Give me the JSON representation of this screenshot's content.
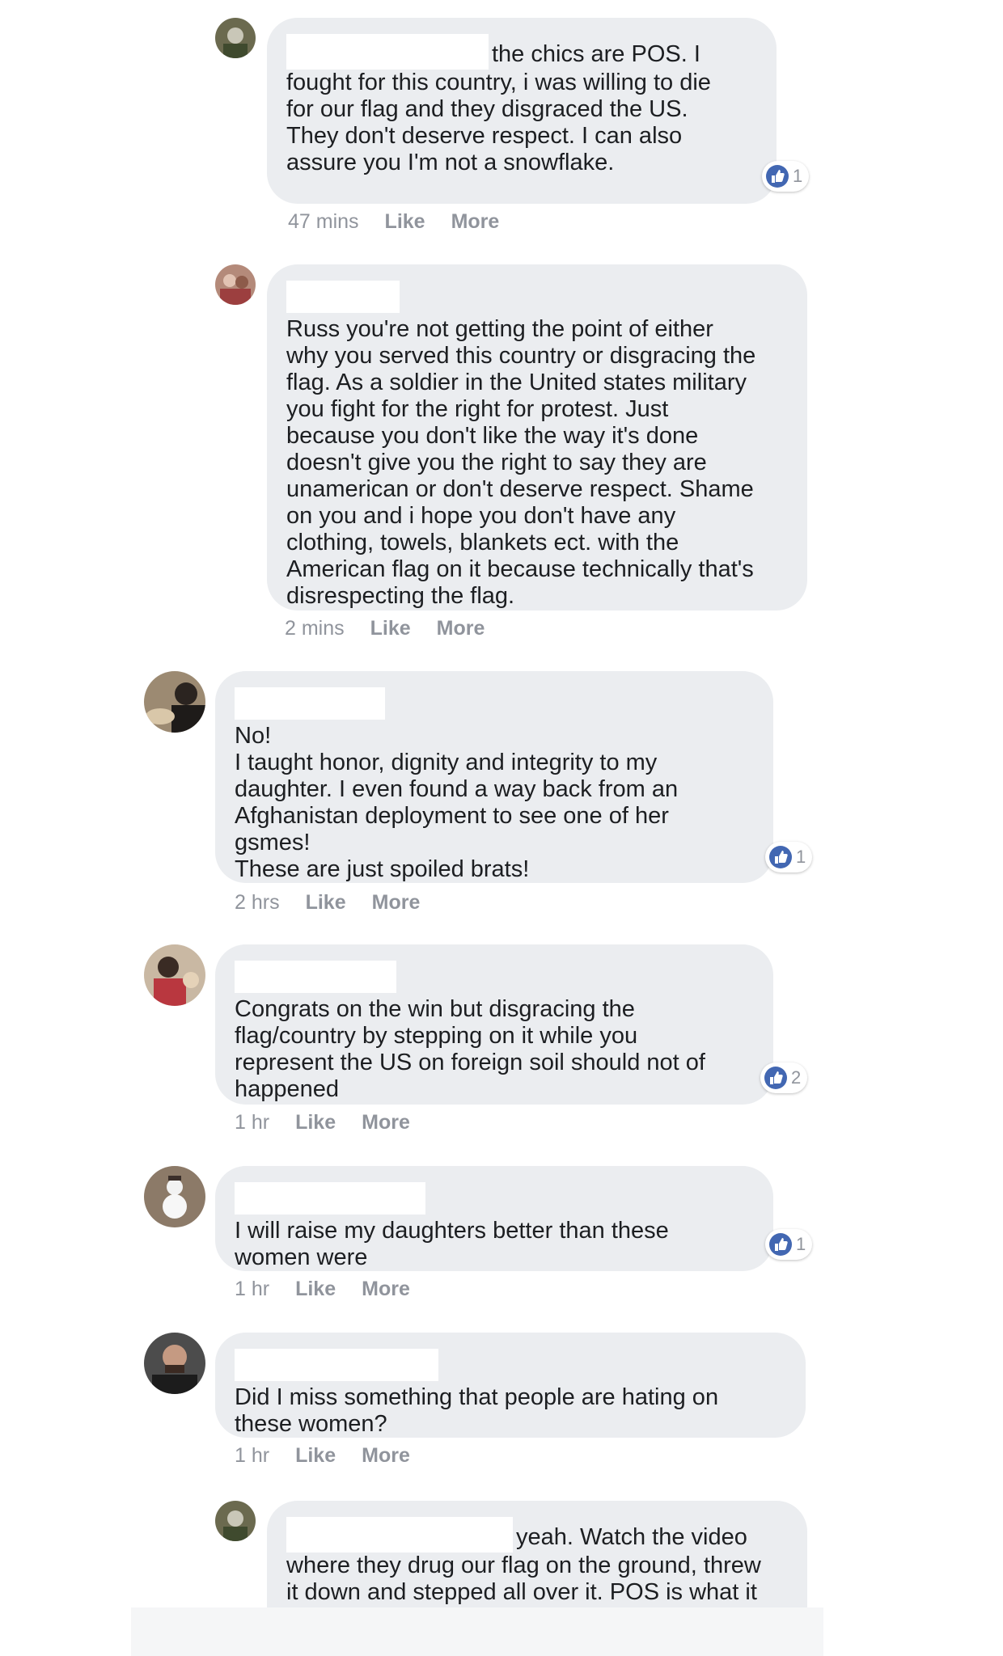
{
  "comments": [
    {
      "text": "fought for this country, i was willing to die\nfor our flag and they disgraced the US.\nThey don't deserve respect. I can also\nassure you I'm not a snowflake.",
      "first_line": "the chics are POS. I",
      "time": "47 mins",
      "like": "Like",
      "more": "More",
      "reactions": "1"
    },
    {
      "text": "Russ you're not getting the point of either\nwhy you served this country or disgracing the\nflag. As a soldier in the United states military\nyou fight for the right for protest. Just\nbecause you don't like the way it's done\ndoesn't give you the right to say they are\nunamerican or don't deserve respect. Shame\non you and i hope you don't have any\nclothing, towels, blankets ect. with the\nAmerican flag on it because technically that's\ndisrespecting the flag.",
      "time": "2 mins",
      "like": "Like",
      "more": "More"
    },
    {
      "text": "No!\nI taught honor, dignity and integrity to my\ndaughter. I even found a way back from an\nAfghanistan deployment to see one of her\ngsmes!\nThese are just spoiled brats!",
      "time": "2 hrs",
      "like": "Like",
      "more": "More",
      "reactions": "1"
    },
    {
      "text": "Congrats on the win but disgracing the\nflag/country by stepping on it while you\nrepresent the US on foreign soil should not of\nhappened",
      "time": "1 hr",
      "like": "Like",
      "more": "More",
      "reactions": "2"
    },
    {
      "text": "I will raise my daughters better than these\nwomen were",
      "time": "1 hr",
      "like": "Like",
      "more": "More",
      "reactions": "1"
    },
    {
      "text": "Did I miss something that people are hating on\nthese women?",
      "time": "1 hr",
      "like": "Like",
      "more": "More"
    },
    {
      "text": "where they drug our flag on the ground, threw\nit down and stepped all over it. POS is what it",
      "first_line": "yeah. Watch the video"
    }
  ],
  "colors": {
    "like_blue": "#4267b2",
    "bubble": "#ebedf0",
    "meta_gray": "#90949c"
  }
}
